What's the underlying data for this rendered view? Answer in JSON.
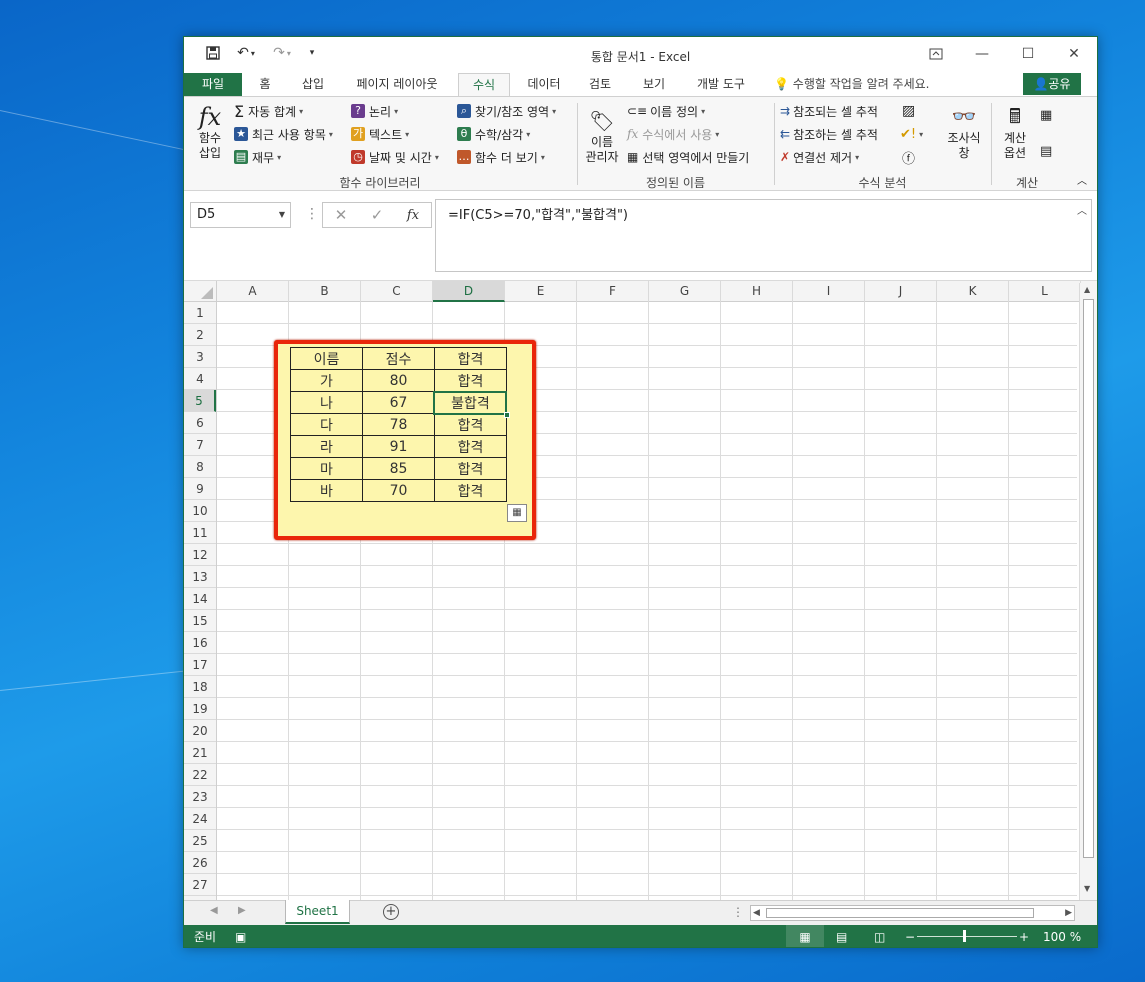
{
  "window": {
    "title": "통합 문서1 - Excel"
  },
  "tabs": {
    "file": "파일",
    "home": "홈",
    "insert": "삽입",
    "page_layout": "페이지 레이아웃",
    "formulas": "수식",
    "data": "데이터",
    "review": "검토",
    "view": "보기",
    "developer": "개발 도구",
    "tell_me": "수행할 작업을 알려 주세요.",
    "share": "공유"
  },
  "ribbon": {
    "insert_function": [
      "함수",
      "삽입"
    ],
    "autosum": "자동 합계",
    "recent": "최근 사용 항목",
    "financial": "재무",
    "logical": "논리",
    "text": "텍스트",
    "datetime": "날짜 및 시간",
    "lookup": "찾기/참조 영역",
    "math": "수학/삼각",
    "more_functions": "함수 더 보기",
    "group_library": "함수 라이브러리",
    "name_manager": [
      "이름",
      "관리자"
    ],
    "define_name": "이름 정의",
    "use_in_formula": "수식에서 사용",
    "create_from_selection": "선택 영역에서 만들기",
    "group_defined_names": "정의된 이름",
    "trace_precedents": "참조되는 셀 추적",
    "trace_dependents": "참조하는 셀 추적",
    "remove_arrows": "연결선 제거",
    "watch_window": [
      "조사식",
      "창"
    ],
    "group_auditing": "수식 분석",
    "calc_options": [
      "계산",
      "옵션"
    ],
    "group_calculation": "계산"
  },
  "formula_bar": {
    "name_box": "D5",
    "formula": "=IF(C5>=70,\"합격\",\"불합격\")"
  },
  "columns": [
    "A",
    "B",
    "C",
    "D",
    "E",
    "F",
    "G",
    "H",
    "I",
    "J",
    "K",
    "L"
  ],
  "selected_column": "D",
  "rows": [
    "1",
    "2",
    "3",
    "4",
    "5",
    "6",
    "7",
    "8",
    "9",
    "10",
    "11",
    "12",
    "13",
    "14",
    "15",
    "16",
    "17",
    "18",
    "19",
    "20",
    "21",
    "22",
    "23",
    "24",
    "25",
    "26",
    "27"
  ],
  "selected_row": "5",
  "table": {
    "headers": [
      "이름",
      "점수",
      "합격"
    ],
    "rows": [
      [
        "가",
        "80",
        "합격"
      ],
      [
        "나",
        "67",
        "불합격"
      ],
      [
        "다",
        "78",
        "합격"
      ],
      [
        "라",
        "91",
        "합격"
      ],
      [
        "마",
        "85",
        "합격"
      ],
      [
        "바",
        "70",
        "합격"
      ]
    ]
  },
  "sheets": [
    "Sheet1"
  ],
  "status": {
    "ready": "준비",
    "zoom": "100 %"
  },
  "colors": {
    "excel_green": "#217346",
    "highlight_fill": "#fdf6ad",
    "highlight_border": "#e9260a"
  }
}
